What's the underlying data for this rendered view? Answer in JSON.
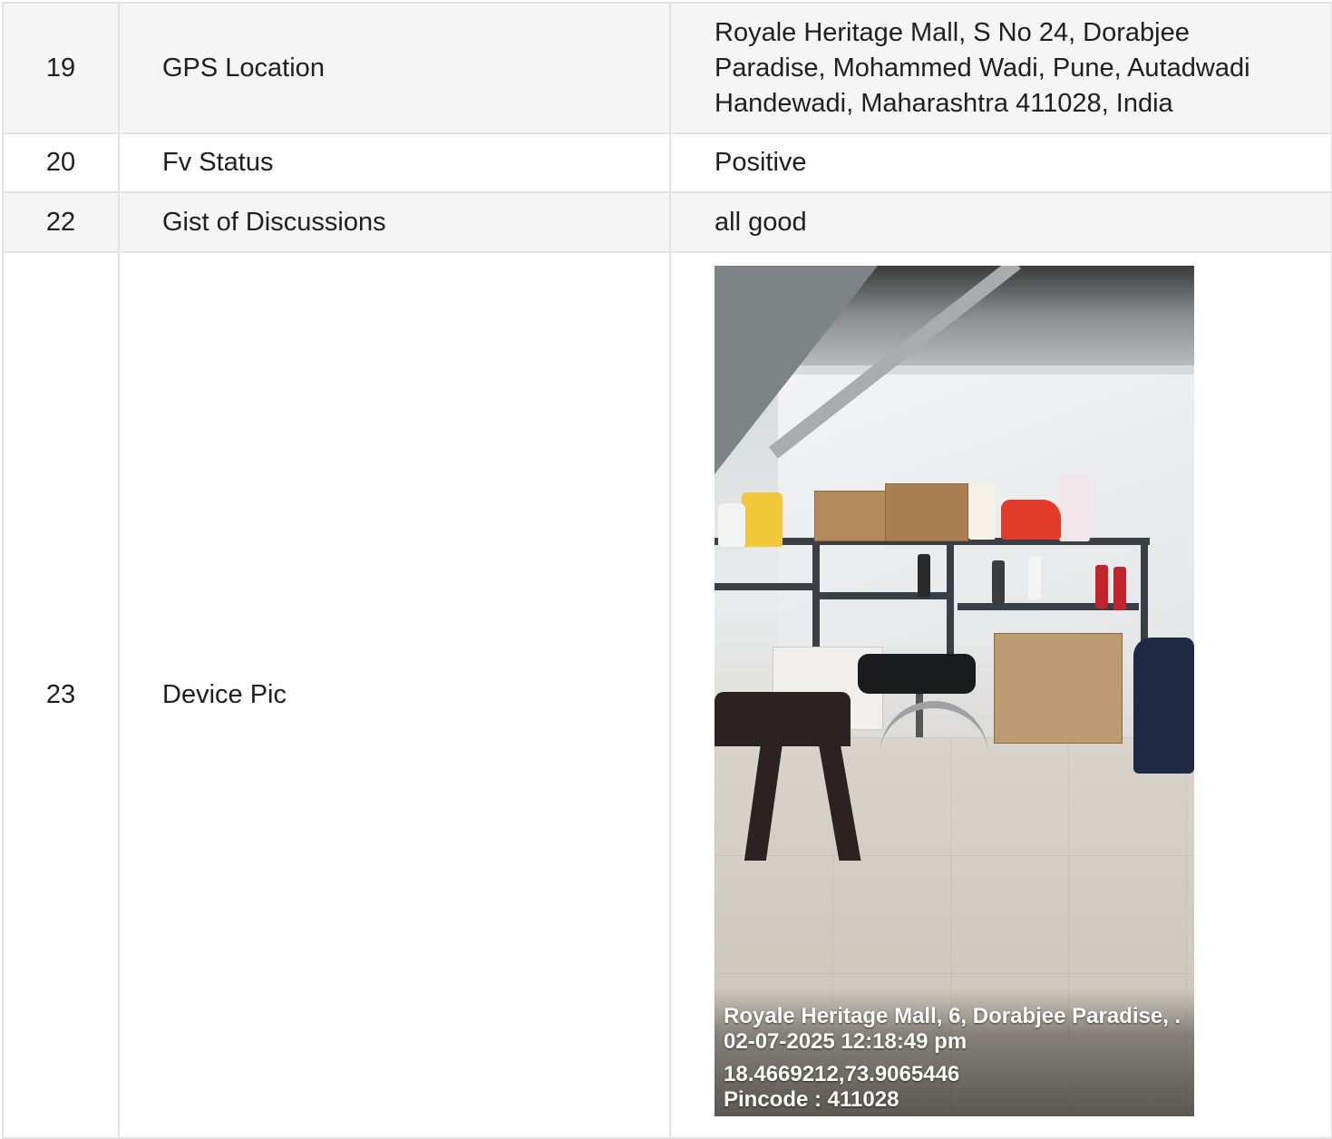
{
  "rows": [
    {
      "num": "19",
      "label": "GPS Location",
      "value_lines": [
        "Royale Heritage Mall, S No 24, Dorabjee",
        "Paradise, Mohammed Wadi, Pune, Autadwadi",
        "Handewadi, Maharashtra 411028, India"
      ]
    },
    {
      "num": "20",
      "label": "Fv Status",
      "value": "Positive"
    },
    {
      "num": "22",
      "label": "Gist of Discussions",
      "value": "all good"
    },
    {
      "num": "23",
      "label": "Device Pic",
      "photo_stamp": {
        "address": "Royale Heritage Mall, 6, Dorabjee Paradise, .",
        "datetime": "02-07-2025 12:18:49 pm",
        "coords": "18.4669212,73.9065446",
        "pincode": "Pincode : 411028"
      }
    }
  ],
  "colors": {
    "border": "#e3e3e3",
    "shaded_row": "#f5f5f5",
    "text": "#1f1f1f"
  }
}
